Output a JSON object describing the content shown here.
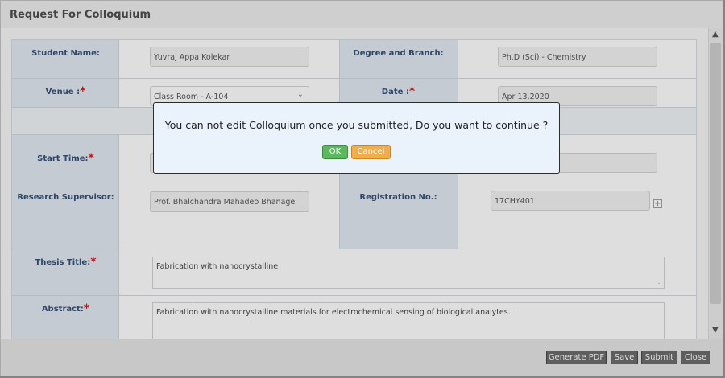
{
  "window": {
    "title": "Request For Colloquium"
  },
  "form": {
    "student_name": {
      "label": "Student Name:",
      "value": "Yuvraj Appa Kolekar"
    },
    "degree_branch": {
      "label": "Degree and Branch:",
      "value": "Ph.D (Sci) - Chemistry"
    },
    "venue": {
      "label": "Venue :",
      "required": "*",
      "value": "Class Room - A-104"
    },
    "date": {
      "label": "Date :",
      "required": "*",
      "value": "Apr 13,2020"
    },
    "start_time": {
      "label": "Start Time:",
      "required": "*",
      "value": ""
    },
    "end_time": {
      "value": ""
    },
    "research_supervisor": {
      "label": "Research Supervisor:",
      "value": "Prof. Bhalchandra Mahadeo Bhanage"
    },
    "registration_no": {
      "label": "Registration No.:",
      "value": "17CHY401"
    },
    "thesis_title": {
      "label": "Thesis Title:",
      "required": "*",
      "value": "Fabrication with nanocrystalline"
    },
    "abstract": {
      "label": "Abstract:",
      "required": "*",
      "value": "Fabrication with nanocrystalline materials for electrochemical sensing of biological analytes."
    }
  },
  "footer": {
    "generate_pdf": "Generate PDF",
    "save": "Save",
    "submit": "Submit",
    "close": "Close"
  },
  "dialog": {
    "message": "You can not edit Colloquium once you submitted, Do you want to continue ?",
    "ok": "OK",
    "cancel": "Cancel"
  },
  "icons": {
    "scroll_up": "chevron-up-icon",
    "scroll_down": "chevron-down-icon",
    "add": "plus-icon"
  }
}
